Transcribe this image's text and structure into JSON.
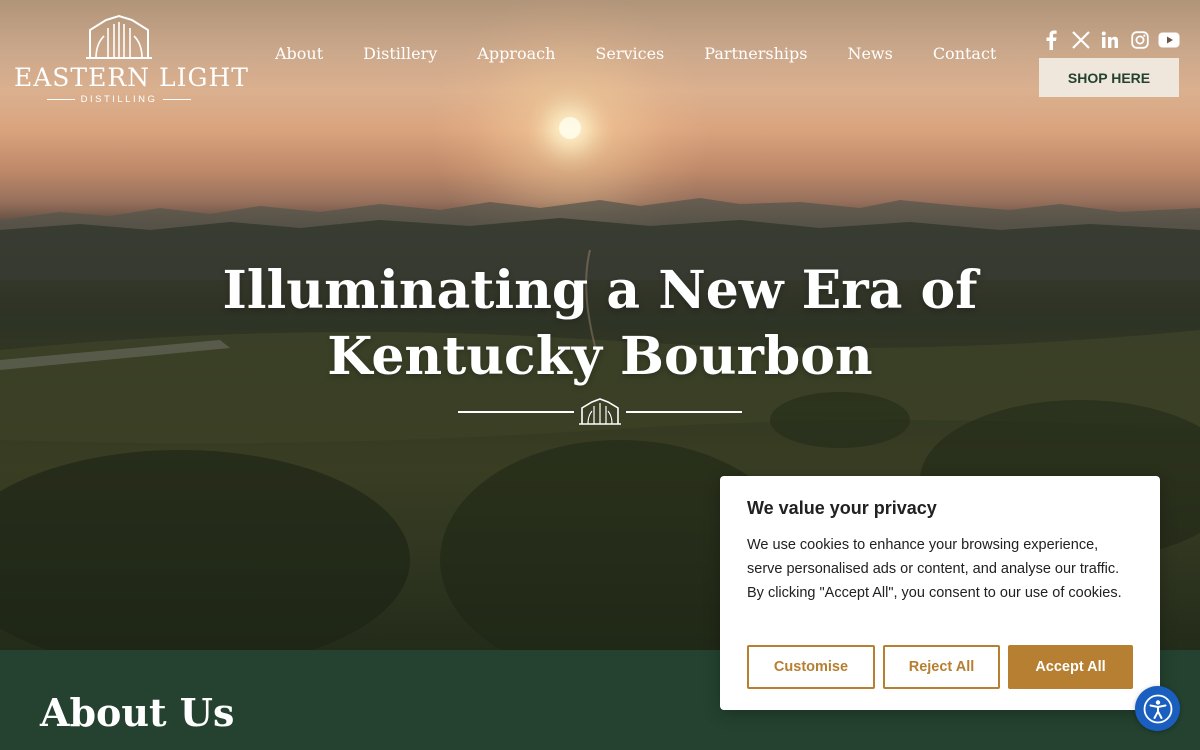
{
  "brand": {
    "name": "EASTERN LIGHT",
    "sub": "DISTILLING"
  },
  "nav": [
    {
      "label": "About"
    },
    {
      "label": "Distillery"
    },
    {
      "label": "Approach"
    },
    {
      "label": "Services"
    },
    {
      "label": "Partnerships"
    },
    {
      "label": "News"
    },
    {
      "label": "Contact"
    }
  ],
  "socials": [
    "facebook-icon",
    "x-icon",
    "linkedin-icon",
    "instagram-icon",
    "youtube-icon"
  ],
  "shop_label": "SHOP HERE",
  "hero": {
    "headline_line1": "Illuminating a New Era of",
    "headline_line2": "Kentucky Bourbon"
  },
  "about": {
    "title": "About Us"
  },
  "cookie": {
    "title": "We value your privacy",
    "text": "We use cookies to enhance your browsing experience, serve personalised ads or content, and analyse our traffic. By clicking \"Accept All\", you consent to our use of cookies.",
    "customise_label": "Customise",
    "reject_label": "Reject All",
    "accept_label": "Accept All"
  },
  "colors": {
    "brand_green": "#24422f",
    "accent_gold": "#b67f31",
    "shop_bg": "#efe6dc",
    "a11y_blue": "#1a5fbf"
  }
}
